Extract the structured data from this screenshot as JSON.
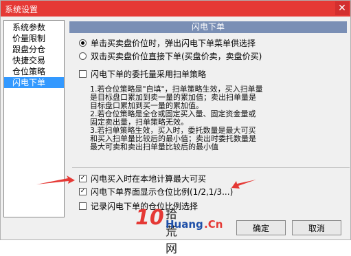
{
  "window": {
    "title": "系统设置",
    "close_glyph": "✕"
  },
  "sidebar": {
    "items": [
      {
        "label": "系统参数",
        "selected": false
      },
      {
        "label": "价量限制",
        "selected": false
      },
      {
        "label": "跟盘分仓",
        "selected": false
      },
      {
        "label": "快捷交易",
        "selected": false
      },
      {
        "label": "仓位策略",
        "selected": false
      },
      {
        "label": "闪电下单",
        "selected": true
      }
    ]
  },
  "panel": {
    "header": "闪电下单",
    "radio_options": [
      {
        "label": "单击买卖盘价位时，弹出闪电下单菜单供选择",
        "checked": true
      },
      {
        "label": "双击买卖盘价位直接下单(买盘价卖，卖盘价买)",
        "checked": false
      }
    ],
    "checkbox_scan": {
      "label": "闪电下单的委托量采用扫单策略",
      "checked": false
    },
    "description": [
      "1.若仓位策略是\"自填\"，扫单策略生效，买入扫单量",
      "是目标盘口累加到卖一量的累加值；卖出扫单量是",
      "目标盘口累加到买一量的累加值。",
      "2.若仓位策略是全仓或固定买入量、固定资金量或",
      "固定卖出量，扫单策略无效。",
      "3.若扫单策略生效，买入时，委托数量是最大可买",
      "和买入扫单量比较后的最小值；卖出时委托数量是",
      "最大可卖和卖出扫单量比较后的最小值"
    ],
    "checkbox_local_calc": {
      "label": "闪电买入时在本地计算最大可买",
      "checked": true
    },
    "checkbox_show_ratio": {
      "label": "闪电下单界面显示仓位比例(1/2,1/3...)",
      "checked": true
    },
    "checkbox_record": {
      "label": "记录闪电下单的仓位比例选择",
      "checked": false
    },
    "check_glyph": "✓"
  },
  "buttons": {
    "ok_label": "确定",
    "cancel_label": "取消"
  },
  "watermark": {
    "brand_num": "10",
    "brand_text": "Huang",
    "brand_domain": ".Cn",
    "brand_cn": "拾荒网"
  },
  "colors": {
    "titlebar": "#e53935",
    "header": "#7a8fb5",
    "selected": "#3399ff",
    "arrow": "#e53935"
  }
}
